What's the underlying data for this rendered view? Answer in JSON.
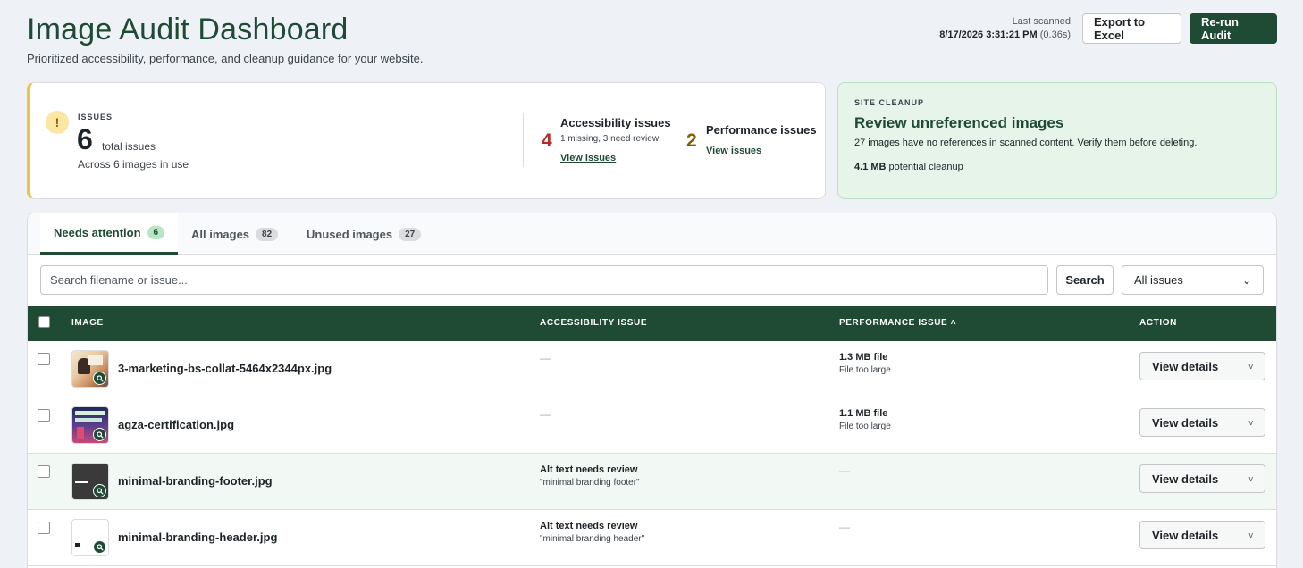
{
  "header": {
    "title": "Image Audit Dashboard",
    "subtitle": "Prioritized accessibility, performance, and cleanup guidance for your website.",
    "last_scanned_label": "Last scanned",
    "last_scanned_value": "8/17/2026 3:31:21 PM",
    "scan_duration": "(0.36s)",
    "export_label": "Export to Excel",
    "rerun_label": "Re-run Audit"
  },
  "issues": {
    "label": "ISSUES",
    "count": "6",
    "total_label": "total issues",
    "across": "Across 6 images in use",
    "accessibility": {
      "count": "4",
      "title": "Accessibility issues",
      "sub": "1 missing, 3 need review",
      "link": "View issues"
    },
    "performance": {
      "count": "2",
      "title": "Performance issues",
      "link": "View issues"
    }
  },
  "cleanup": {
    "label": "SITE CLEANUP",
    "title": "Review unreferenced images",
    "desc": "27 images have no references in scanned content. Verify them before deleting.",
    "size": "4.1 MB",
    "size_suffix": " potential cleanup"
  },
  "tabs": [
    {
      "label": "Needs attention",
      "count": "6"
    },
    {
      "label": "All images",
      "count": "82"
    },
    {
      "label": "Unused images",
      "count": "27"
    }
  ],
  "search": {
    "placeholder": "Search filename or issue...",
    "button": "Search",
    "filter": "All issues"
  },
  "table": {
    "headers": {
      "image": "IMAGE",
      "accessibility": "ACCESSIBILITY ISSUE",
      "performance": "PERFORMANCE ISSUE ˄",
      "action": "ACTION"
    },
    "rows": [
      {
        "filename": "3-marketing-bs-collat-5464x2344px.jpg",
        "a11y_title": "—",
        "a11y_sub": "",
        "perf_title": "1.3 MB file",
        "perf_sub": "File too large",
        "action": "View details"
      },
      {
        "filename": "agza-certification.jpg",
        "a11y_title": "—",
        "a11y_sub": "",
        "perf_title": "1.1 MB file",
        "perf_sub": "File too large",
        "action": "View details"
      },
      {
        "filename": "minimal-branding-footer.jpg",
        "a11y_title": "Alt text needs review",
        "a11y_sub": "\"minimal branding footer\"",
        "perf_title": "—",
        "perf_sub": "",
        "action": "View details"
      },
      {
        "filename": "minimal-branding-header.jpg",
        "a11y_title": "Alt text needs review",
        "a11y_sub": "\"minimal branding header\"",
        "perf_title": "—",
        "perf_sub": "",
        "action": "View details"
      }
    ]
  },
  "colors": {
    "brand_green": "#1f4a34",
    "accessibility_red": "#b32d2e",
    "performance_amber": "#8a5a00",
    "warning_yellow": "#f0c33c"
  }
}
